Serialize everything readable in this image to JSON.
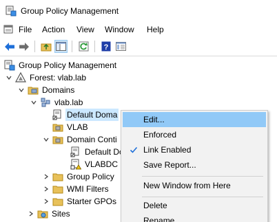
{
  "window": {
    "title": "Group Policy Management"
  },
  "menu": [
    "File",
    "Action",
    "View",
    "Window",
    "Help"
  ],
  "toolbar": [
    {
      "name": "back-icon"
    },
    {
      "name": "forward-icon"
    },
    {
      "name": "up-folder-icon"
    },
    {
      "name": "show-hide-tree-icon"
    },
    {
      "name": "refresh-icon"
    },
    {
      "name": "help-icon"
    },
    {
      "name": "properties-icon"
    }
  ],
  "tree": {
    "root": "Group Policy Management",
    "forest": "Forest: vlab.lab",
    "domains": "Domains",
    "domain": "vlab.lab",
    "default_policy": "Default Doma",
    "vlab": "VLAB",
    "domain_controllers": "Domain Conti",
    "default_dc_policy": "Default Do",
    "vlabdc": "VLABDC",
    "gpo": "Group Policy",
    "wmi": "WMI Filters",
    "starter": "Starter GPOs",
    "sites": "Sites"
  },
  "context_menu": {
    "edit": "Edit...",
    "enforced": "Enforced",
    "link_enabled": "Link Enabled",
    "save_report": "Save Report...",
    "new_window": "New Window from Here",
    "delete": "Delete",
    "rename": "Rename"
  },
  "colors": {
    "highlight": "#91c9f7",
    "selection": "#cce8ff",
    "accent": "#1e6fd9"
  }
}
